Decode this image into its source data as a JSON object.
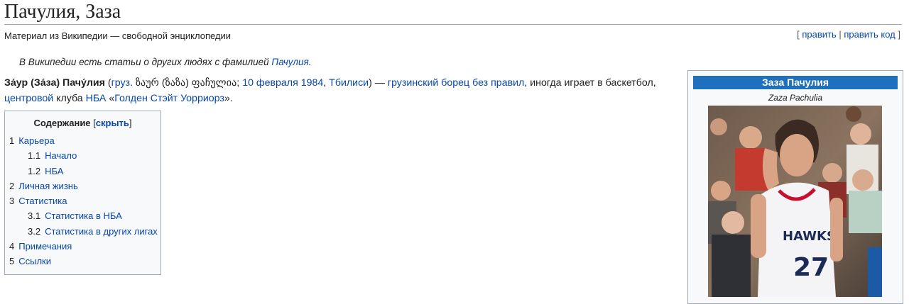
{
  "page": {
    "title": "Пачулия, Заза",
    "tagline": "Материал из Википедии — свободной энциклопедии",
    "edit_links": {
      "open": "[ ",
      "edit": "править",
      "sep": " | ",
      "edit_source": "править код",
      "close": " ]"
    },
    "hatnote": {
      "text": "В Википедии есть статьи о других людях с фамилией ",
      "link": "Пачулия",
      "end": "."
    }
  },
  "lead": {
    "name_bold": "За́ур (За́за) Пачу́лия",
    "p1": " (",
    "lang_link": "груз.",
    "georgian": " ზაურ (ზაზა) ფაჩულია",
    "semi": "; ",
    "date_link": "10 февраля 1984",
    "comma": ", ",
    "city_link": "Тбилиси",
    "p2": ") — ",
    "role_link": "грузинский борец без правил",
    "p3": ", иногда играет в баскетбол,",
    "position_link": "центровой",
    "p4": " клуба ",
    "league_link": "НБА",
    "p5": " «",
    "team_link": "Голден Стэйт Уорриорз",
    "p6": "»."
  },
  "toc": {
    "title": "Содержание",
    "toggle_open": " [",
    "toggle": "скрыть",
    "toggle_close": "]",
    "items": [
      {
        "num": "1",
        "label": "Карьера",
        "level": 1
      },
      {
        "num": "1.1",
        "label": "Начало",
        "level": 2
      },
      {
        "num": "1.2",
        "label": "НБА",
        "level": 2
      },
      {
        "num": "2",
        "label": "Личная жизнь",
        "level": 1
      },
      {
        "num": "3",
        "label": "Статистика",
        "level": 1
      },
      {
        "num": "3.1",
        "label": "Статистика в НБА",
        "level": 2
      },
      {
        "num": "3.2",
        "label": "Статистика в других лигах",
        "level": 2
      },
      {
        "num": "4",
        "label": "Примечания",
        "level": 1
      },
      {
        "num": "5",
        "label": "Ссылки",
        "level": 1
      }
    ]
  },
  "infobox": {
    "title": "Заза Пачулия",
    "subtitle": "Zaza Pachulia",
    "header_color": "#1f6fbf",
    "jersey": {
      "team": "HAWKS",
      "number": "27"
    }
  },
  "colors": {
    "link": "#0645ad",
    "text": "#202122",
    "border": "#a2a9b1"
  }
}
